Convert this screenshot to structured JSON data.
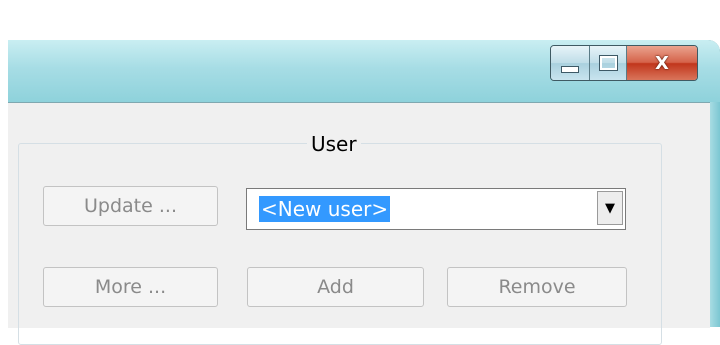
{
  "window": {
    "close_glyph": "X",
    "min_icon": "minimize-icon",
    "max_icon": "maximize-icon"
  },
  "group": {
    "legend": "User",
    "buttons": {
      "update": "Update ...",
      "more": "More ...",
      "add": "Add",
      "remove": "Remove"
    },
    "combo": {
      "value": "<New user>",
      "arrow": "▼"
    }
  },
  "colors": {
    "selection": "#3399ff",
    "disabled_text": "#8a8a8a",
    "close": "#c1361c"
  }
}
